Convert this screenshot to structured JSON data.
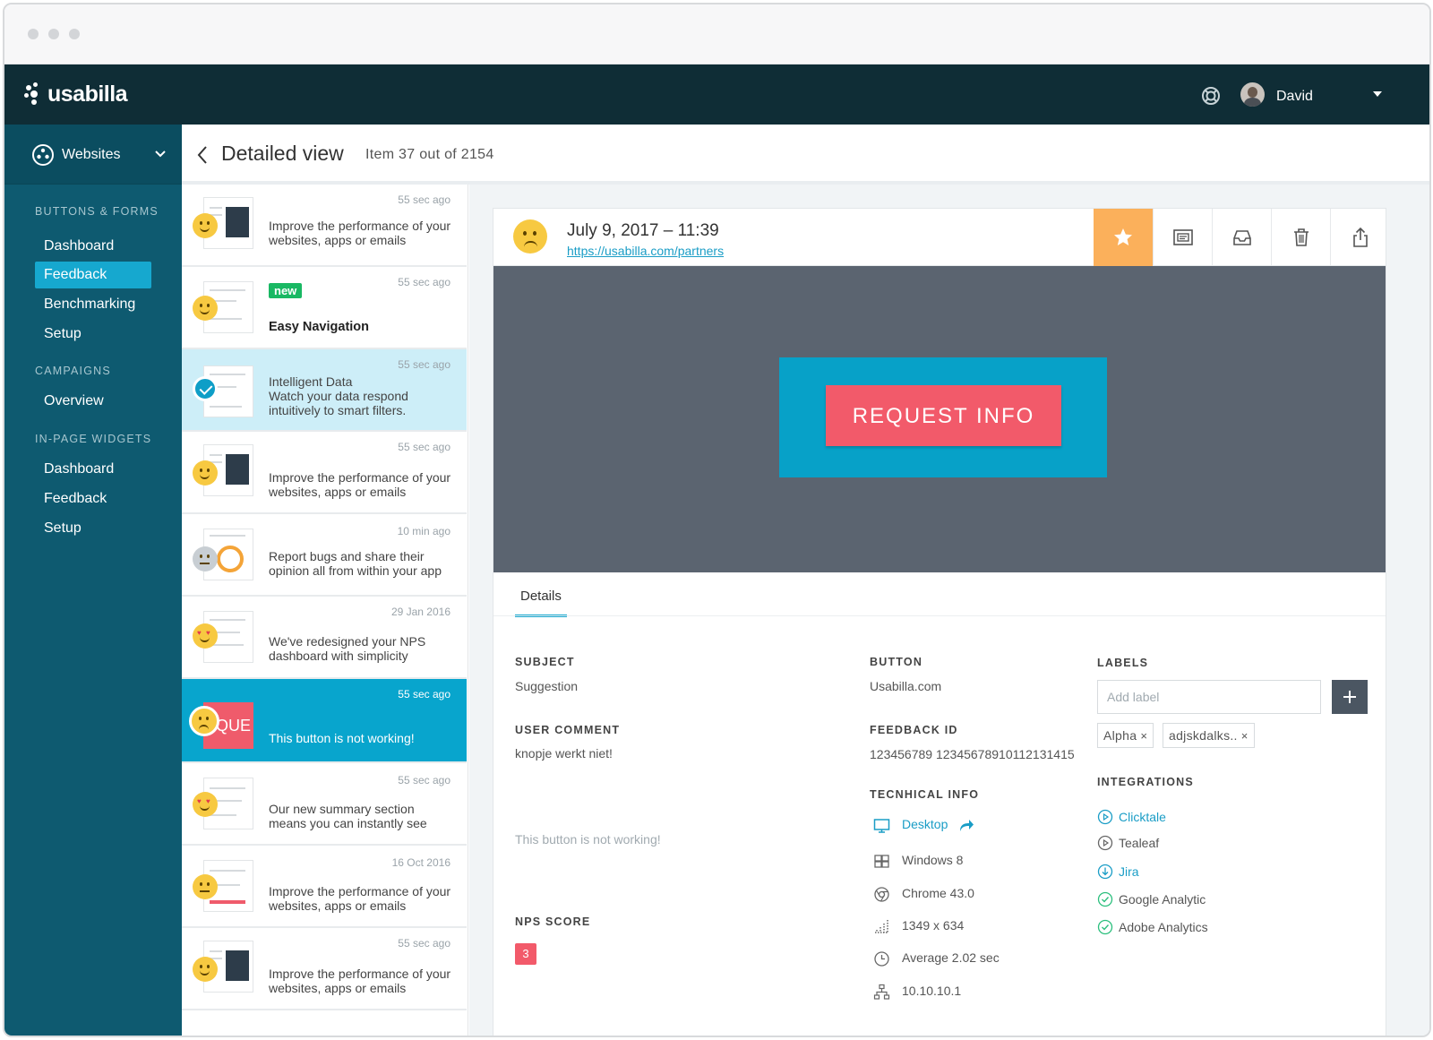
{
  "app": {
    "brand": "usabilla",
    "user_name": "David"
  },
  "sidebar": {
    "workspace": "Websites",
    "sections": [
      {
        "title": "BUTTONS & FORMS",
        "items": [
          "Dashboard",
          "Feedback",
          "Benchmarking",
          "Setup"
        ]
      },
      {
        "title": "CAMPAIGNS",
        "items": [
          "Overview"
        ]
      },
      {
        "title": "IN-PAGE WIDGETS",
        "items": [
          "Dashboard",
          "Feedback",
          "Setup"
        ]
      }
    ],
    "active_item": "Feedback"
  },
  "header": {
    "title": "Detailed view",
    "item_count": "Item 37 out of 2154"
  },
  "feedback_list": [
    {
      "time": "55 sec ago",
      "text": "Improve the performance of your websites, apps or emails",
      "mood": "happy"
    },
    {
      "time": "55 sec ago",
      "badge": "new",
      "title": "Easy Navigation",
      "mood": "happy"
    },
    {
      "time": "55 sec ago",
      "text": "Intelligent Data\nWatch your data respond intuitively to smart filters.",
      "state": "checked"
    },
    {
      "time": "55 sec ago",
      "text": "Improve the performance of your websites, apps or emails",
      "mood": "happy"
    },
    {
      "time": "10 min ago",
      "text": "Report bugs and share their opinion all from within your app",
      "mood": "neutral"
    },
    {
      "time": "29 Jan 2016",
      "text": "We've redesigned your NPS dashboard with simplicity",
      "mood": "love"
    },
    {
      "time": "55 sec ago",
      "text": "This button is not working!",
      "mood": "sad",
      "state": "active",
      "thumb_text": "QUE"
    },
    {
      "time": "55 sec ago",
      "text": "Our new summary section means you can instantly see",
      "mood": "love"
    },
    {
      "time": "16 Oct 2016",
      "text": "Improve the performance of your websites, apps or emails",
      "mood": "flat"
    },
    {
      "time": "55 sec ago",
      "text": "Improve the performance of your websites, apps or emails",
      "mood": "happy"
    }
  ],
  "detail": {
    "date": "July 9, 2017 – 11:39",
    "url": "https://usabilla.com/partners",
    "tools": [
      "star-icon",
      "screenshot-icon",
      "inbox-icon",
      "trash-icon",
      "share-icon"
    ],
    "screenshot_button": "REQUEST INFO",
    "tab": "Details",
    "subject_label": "SUBJECT",
    "subject": "Suggestion",
    "comment_label": "USER COMMENT",
    "comment": "knopje werkt niet!",
    "comment_extra": "This button is not working!",
    "nps_label": "NPS SCORE",
    "nps": "3",
    "button_label": "BUTTON",
    "button": "Usabilla.com",
    "feedback_id_label": "FEEDBACK ID",
    "feedback_id": "123456789 12345678910112131415",
    "tech_label": "TECNHICAL INFO",
    "tech": {
      "device": "Desktop",
      "os": "Windows 8",
      "browser": "Chrome 43.0",
      "resolution": "1349 x 634",
      "load_time": "Average 2.02 sec",
      "ip": "10.10.10.1"
    },
    "labels_label": "LABELS",
    "label_placeholder": "Add label",
    "labels": [
      "Alpha",
      "adjskdalks.."
    ],
    "integrations_label": "INTEGRATIONS",
    "integrations": [
      {
        "name": "Clicktale",
        "state": "play",
        "color": "#1a9dc6"
      },
      {
        "name": "Tealeaf",
        "state": "play",
        "color": "#555555"
      },
      {
        "name": "Jira",
        "state": "download",
        "color": "#1a9dc6"
      },
      {
        "name": "Google Analytic",
        "state": "done",
        "color": "#555555"
      },
      {
        "name": "Adobe Analytics",
        "state": "done",
        "color": "#555555"
      }
    ]
  },
  "colors": {
    "topbar": "#0f2d36",
    "sidebar": "#0e5a70",
    "accent": "#16a8cf",
    "star": "#fbb05b",
    "cta": "#f25a6a",
    "success": "#2bbf7d"
  }
}
